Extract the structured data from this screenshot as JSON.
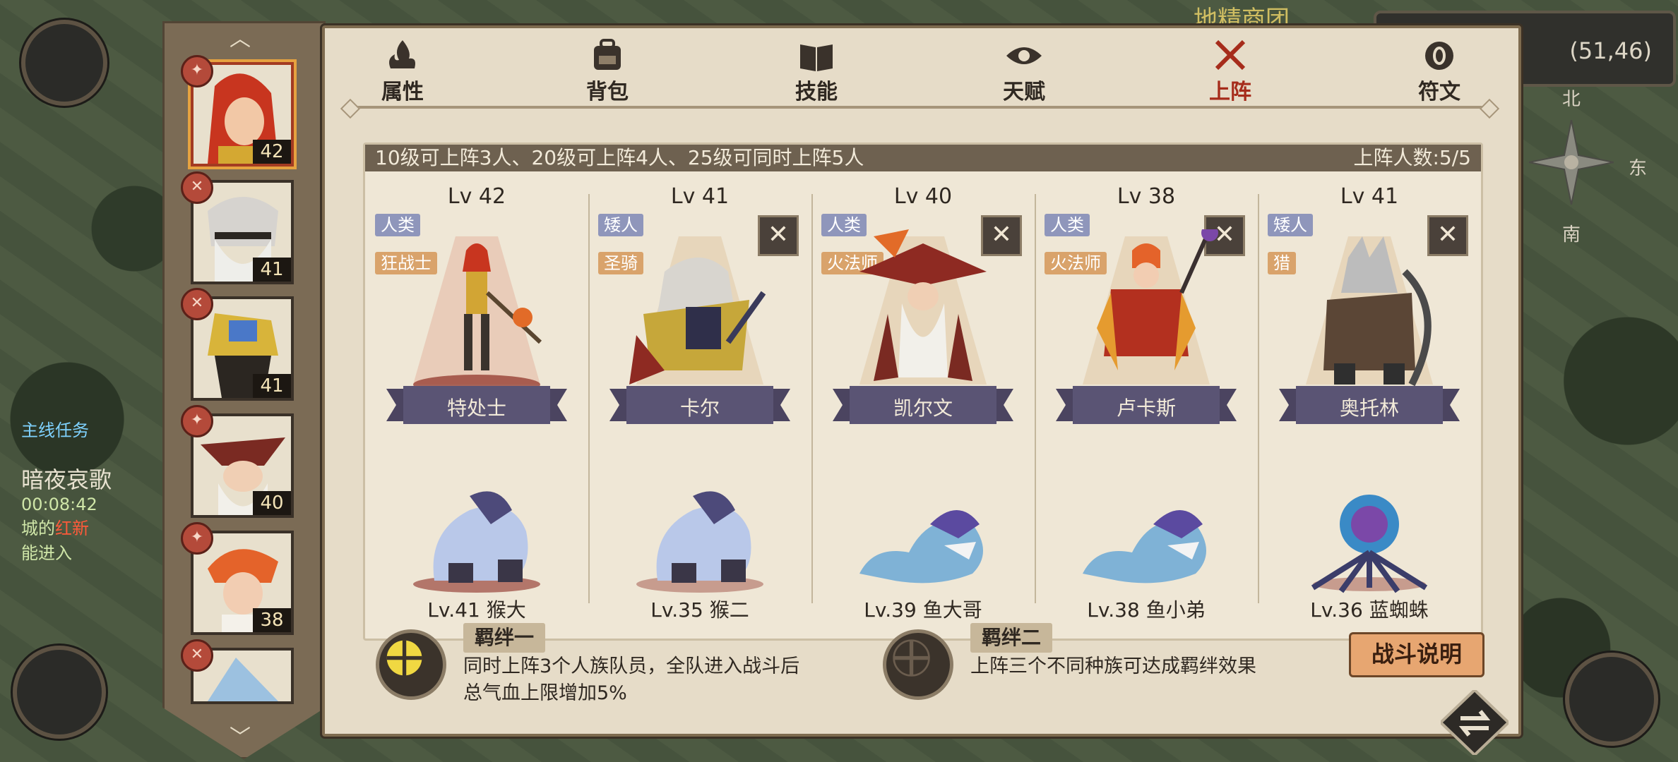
{
  "map": {
    "coordinates": "(51,46)",
    "shop_name": "地精商团",
    "compass": {
      "north": "北",
      "east": "东",
      "south": "南"
    },
    "quest": {
      "header": "主线任务",
      "name": "暗夜哀歌",
      "timer": "00:08:42",
      "line1": "城的",
      "line2": "红新",
      "line3": "能进入"
    }
  },
  "tabs": [
    {
      "label": "属性",
      "icon": "flame-icon"
    },
    {
      "label": "背包",
      "icon": "backpack-icon"
    },
    {
      "label": "技能",
      "icon": "book-icon"
    },
    {
      "label": "天赋",
      "icon": "eye-icon"
    },
    {
      "label": "上阵",
      "icon": "crossed-swords-icon",
      "active": true
    },
    {
      "label": "符文",
      "icon": "rune-icon"
    }
  ],
  "hero_list": [
    {
      "level": "42",
      "badge": "✦",
      "selected": true
    },
    {
      "level": "41",
      "badge": "✕"
    },
    {
      "level": "41",
      "badge": "✕"
    },
    {
      "level": "40",
      "badge": "✦"
    },
    {
      "level": "38",
      "badge": "✦"
    },
    {
      "level": "",
      "badge": "✕"
    }
  ],
  "lineup": {
    "rule_text": "10级可上阵3人、20级可上阵4人、25级可同时上阵5人",
    "count_text": "上阵人数:5/5",
    "heroes": [
      {
        "level": "Lv 42",
        "race": "人类",
        "job": "狂战士",
        "name": "特处士",
        "pet": "Lv.41 猴大",
        "removable": false
      },
      {
        "level": "Lv 41",
        "race": "矮人",
        "job": "圣骑",
        "name": "卡尔",
        "pet": "Lv.35 猴二",
        "removable": true
      },
      {
        "level": "Lv 40",
        "race": "人类",
        "job": "火法师",
        "name": "凯尔文",
        "pet": "Lv.39 鱼大哥",
        "removable": true
      },
      {
        "level": "Lv 38",
        "race": "人类",
        "job": "火法师",
        "name": "卢卡斯",
        "pet": "Lv.38 鱼小弟",
        "removable": true
      },
      {
        "level": "Lv 41",
        "race": "矮人",
        "job": "猎",
        "name": "奥托林",
        "pet": "Lv.36 蓝蜘蛛",
        "removable": true
      }
    ],
    "remove_label": "✕"
  },
  "bonds": [
    {
      "title": "羁绊一",
      "desc_line1": "同时上阵3个人族队员，全队进入战斗后",
      "desc_line2": "总气血上限增加5%",
      "active": true
    },
    {
      "title": "羁绊二",
      "desc_line1": "上阵三个不同种族可达成羁绊效果",
      "desc_line2": "",
      "active": false
    }
  ],
  "battle_button": "战斗说明",
  "colors": {
    "accent": "#a62c1b",
    "panel": "#e6dcc8",
    "header": "#6e6150",
    "button": "#e7a671"
  }
}
